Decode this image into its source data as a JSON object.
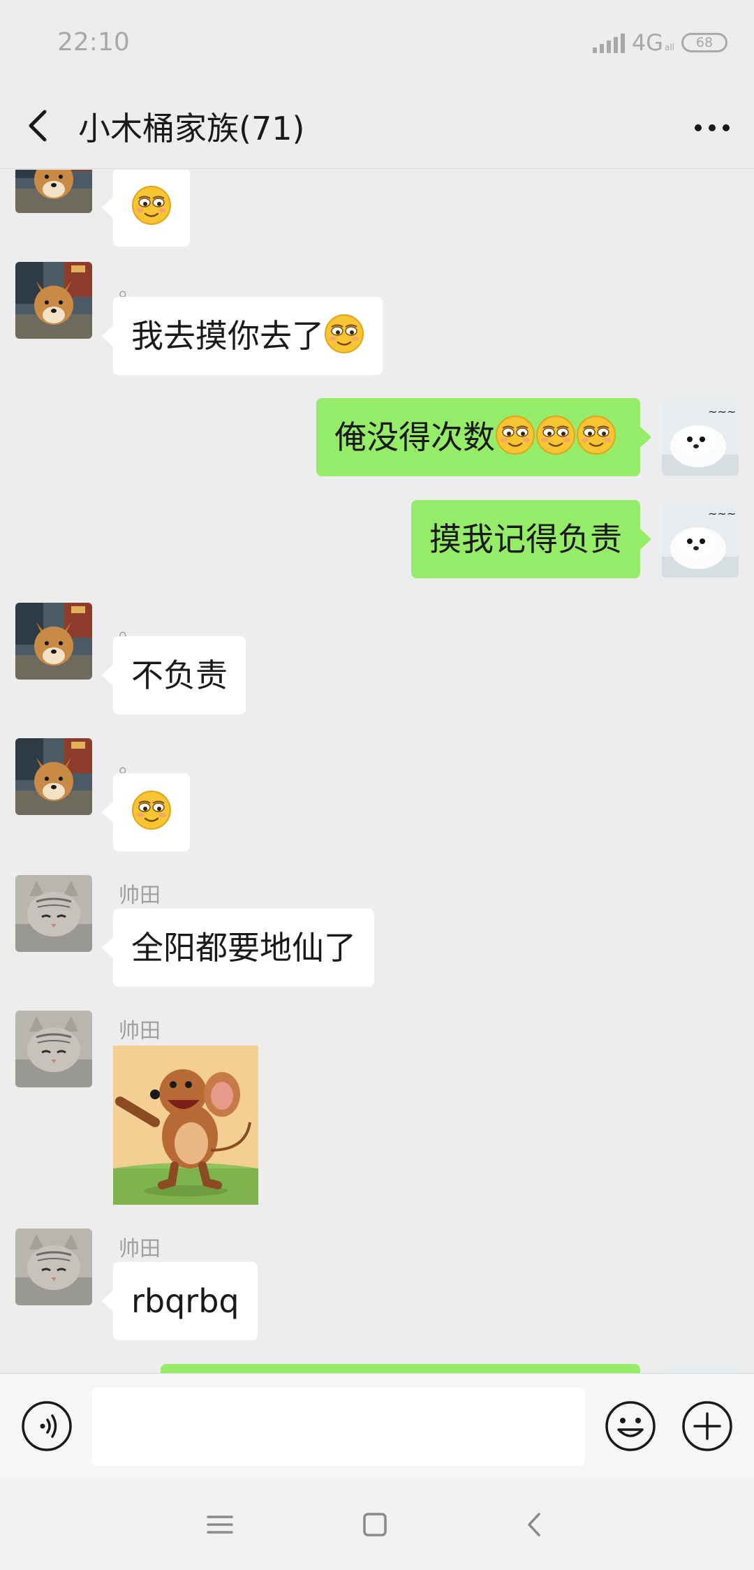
{
  "status_bar": {
    "time": "22:10",
    "network": "4G",
    "network_sub": "all",
    "battery": "68"
  },
  "header": {
    "title": "小木桶家族(71)"
  },
  "messages": [
    {
      "dir": "in",
      "sender": "",
      "avatar": "shiba-avatar",
      "text": "",
      "emoji_count": 1
    },
    {
      "dir": "in",
      "sender": "。",
      "avatar": "shiba-avatar",
      "text": "我去摸你去了",
      "emoji_count": 1
    },
    {
      "dir": "out",
      "avatar": "seal-avatar",
      "text": "俺没得次数",
      "emoji_count": 3
    },
    {
      "dir": "out",
      "avatar": "seal-avatar",
      "text": "摸我记得负责",
      "emoji_count": 0
    },
    {
      "dir": "in",
      "sender": "。",
      "avatar": "shiba-avatar",
      "text": "不负责",
      "emoji_count": 0
    },
    {
      "dir": "in",
      "sender": "。",
      "avatar": "shiba-avatar",
      "text": "",
      "emoji_count": 1
    },
    {
      "dir": "in",
      "sender": "帅田",
      "avatar": "cat-avatar",
      "text": "全阳都要地仙了",
      "emoji_count": 0
    },
    {
      "dir": "in",
      "sender": "帅田",
      "avatar": "cat-avatar",
      "sticker": "jerry-mouse-sticker"
    },
    {
      "dir": "in",
      "sender": "帅田",
      "avatar": "cat-avatar",
      "text": "rbqrbq",
      "emoji_count": 0
    }
  ],
  "input": {
    "value": "",
    "placeholder": ""
  },
  "colors": {
    "background": "#ededed",
    "outgoing_bubble": "#95ec69",
    "incoming_bubble": "#ffffff",
    "nickname": "#a0a0a0"
  }
}
